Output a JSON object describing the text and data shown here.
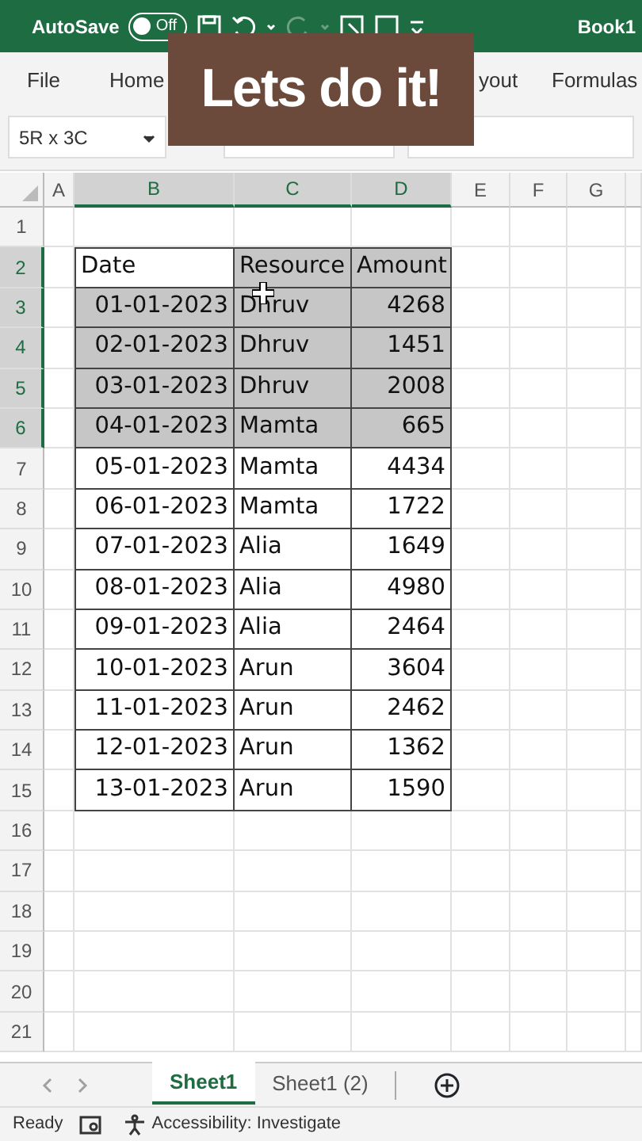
{
  "title_bar": {
    "autosave_label": "AutoSave",
    "autosave_toggle": {
      "label": "Off",
      "on": false
    },
    "document_title": "Book1"
  },
  "ribbon_tabs": [
    {
      "label": "File"
    },
    {
      "label": "Home"
    },
    {
      "label": "yout"
    },
    {
      "label": "Formulas"
    }
  ],
  "name_box": {
    "value": "5R x 3C"
  },
  "caption": "Lets do it!",
  "columns": [
    {
      "label": "A",
      "selected": false
    },
    {
      "label": "B",
      "selected": true
    },
    {
      "label": "C",
      "selected": true
    },
    {
      "label": "D",
      "selected": true
    },
    {
      "label": "E",
      "selected": false
    },
    {
      "label": "F",
      "selected": false
    },
    {
      "label": "G",
      "selected": false
    }
  ],
  "rows": [
    {
      "label": "1",
      "selected": false,
      "kind": "empty"
    },
    {
      "label": "2",
      "selected": true,
      "kind": "header",
      "cells": [
        "Date",
        "Resource",
        "Amount"
      ]
    },
    {
      "label": "3",
      "selected": true,
      "kind": "data",
      "cells": [
        "01-01-2023",
        "Dhruv",
        "4268"
      ]
    },
    {
      "label": "4",
      "selected": true,
      "kind": "data",
      "cells": [
        "02-01-2023",
        "Dhruv",
        "1451"
      ]
    },
    {
      "label": "5",
      "selected": true,
      "kind": "data",
      "cells": [
        "03-01-2023",
        "Dhruv",
        "2008"
      ]
    },
    {
      "label": "6",
      "selected": true,
      "kind": "data",
      "cells": [
        "04-01-2023",
        "Mamta",
        "665"
      ]
    },
    {
      "label": "7",
      "selected": false,
      "kind": "data",
      "cells": [
        "05-01-2023",
        "Mamta",
        "4434"
      ]
    },
    {
      "label": "8",
      "selected": false,
      "kind": "data",
      "cells": [
        "06-01-2023",
        "Mamta",
        "1722"
      ]
    },
    {
      "label": "9",
      "selected": false,
      "kind": "data",
      "cells": [
        "07-01-2023",
        "Alia",
        "1649"
      ]
    },
    {
      "label": "10",
      "selected": false,
      "kind": "data",
      "cells": [
        "08-01-2023",
        "Alia",
        "4980"
      ]
    },
    {
      "label": "11",
      "selected": false,
      "kind": "data",
      "cells": [
        "09-01-2023",
        "Alia",
        "2464"
      ]
    },
    {
      "label": "12",
      "selected": false,
      "kind": "data",
      "cells": [
        "10-01-2023",
        "Arun",
        "3604"
      ]
    },
    {
      "label": "13",
      "selected": false,
      "kind": "data",
      "cells": [
        "11-01-2023",
        "Arun",
        "2462"
      ]
    },
    {
      "label": "14",
      "selected": false,
      "kind": "data",
      "cells": [
        "12-01-2023",
        "Arun",
        "1362"
      ]
    },
    {
      "label": "15",
      "selected": false,
      "kind": "data",
      "cells": [
        "13-01-2023",
        "Arun",
        "1590"
      ]
    },
    {
      "label": "16",
      "selected": false,
      "kind": "empty"
    },
    {
      "label": "17",
      "selected": false,
      "kind": "empty"
    },
    {
      "label": "18",
      "selected": false,
      "kind": "empty"
    },
    {
      "label": "19",
      "selected": false,
      "kind": "empty"
    },
    {
      "label": "20",
      "selected": false,
      "kind": "empty"
    },
    {
      "label": "21",
      "selected": false,
      "kind": "empty"
    }
  ],
  "sheet_tabs": [
    {
      "label": "Sheet1",
      "selected": true
    },
    {
      "label": "Sheet1 (2)",
      "selected": false
    }
  ],
  "status_bar": {
    "status": "Ready",
    "accessibility": "Accessibility: Investigate"
  }
}
